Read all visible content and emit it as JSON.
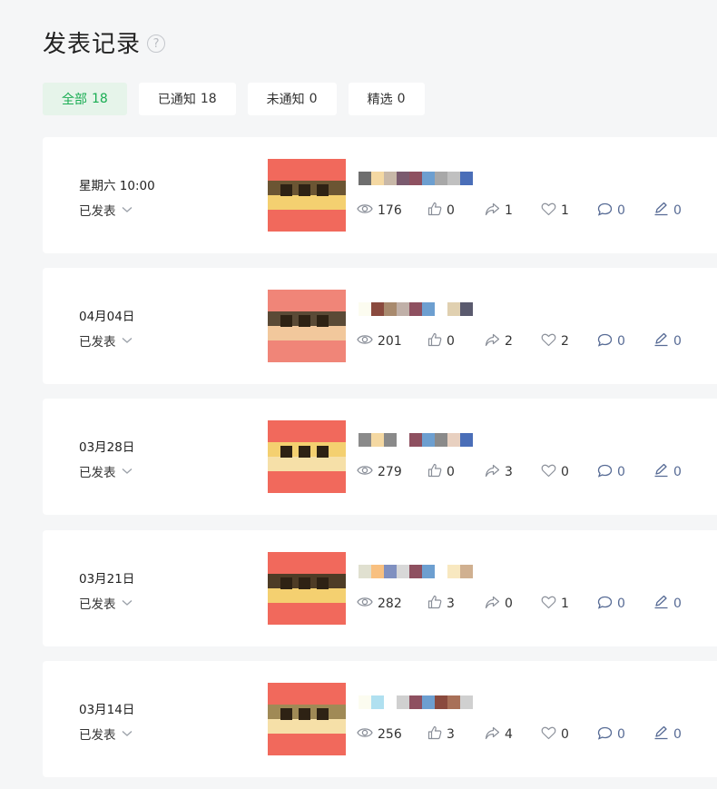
{
  "page": {
    "title": "发表记录",
    "help_icon": "question-circle-icon"
  },
  "filters": [
    {
      "label": "全部",
      "count": "18",
      "active": true
    },
    {
      "label": "已通知",
      "count": "18",
      "active": false
    },
    {
      "label": "未通知",
      "count": "0",
      "active": false
    },
    {
      "label": "精选",
      "count": "0",
      "active": false
    }
  ],
  "colors": {
    "accent": "#1aad53",
    "active_tab_bg": "#e6f4ea",
    "link": "#576b95"
  },
  "records": [
    {
      "date": "星期六 10:00",
      "status": "已发表",
      "reads": "176",
      "likes": "0",
      "shares": "1",
      "favorites": "1",
      "comments": "0",
      "notes": "0"
    },
    {
      "date": "04月04日",
      "status": "已发表",
      "reads": "201",
      "likes": "0",
      "shares": "2",
      "favorites": "2",
      "comments": "0",
      "notes": "0"
    },
    {
      "date": "03月28日",
      "status": "已发表",
      "reads": "279",
      "likes": "0",
      "shares": "3",
      "favorites": "0",
      "comments": "0",
      "notes": "0"
    },
    {
      "date": "03月21日",
      "status": "已发表",
      "reads": "282",
      "likes": "3",
      "shares": "0",
      "favorites": "1",
      "comments": "0",
      "notes": "0"
    },
    {
      "date": "03月14日",
      "status": "已发表",
      "reads": "256",
      "likes": "3",
      "shares": "4",
      "favorites": "0",
      "comments": "0",
      "notes": "0"
    }
  ],
  "icons": {
    "reads": "eye-icon",
    "likes": "thumbs-up-icon",
    "shares": "share-icon",
    "favorites": "heart-icon",
    "comments": "comment-icon",
    "notes": "pen-icon",
    "status": "chevron-down-icon"
  }
}
